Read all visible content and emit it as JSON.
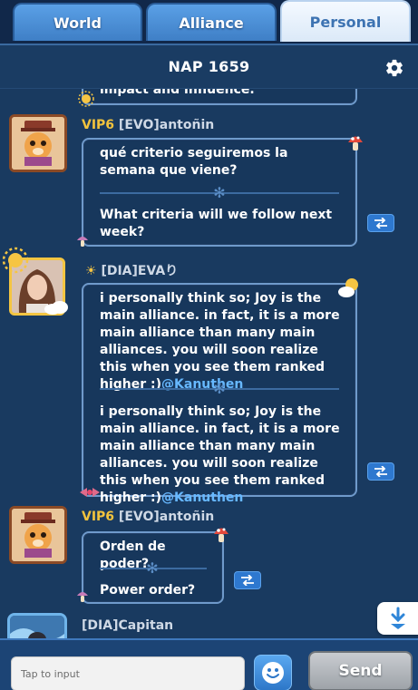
{
  "tabs": [
    {
      "label": "World",
      "active": false
    },
    {
      "label": "Alliance",
      "active": false
    },
    {
      "label": "Personal",
      "active": true
    }
  ],
  "header": {
    "title": "NAP 1659",
    "settings_icon": "gear-icon"
  },
  "messages": [
    {
      "partial_text": "impact and influence."
    },
    {
      "vip": "VIP6",
      "sender": "[EVO]antoñin",
      "original": "qué criterio seguiremos la semana que viene?",
      "translated": "What criteria will we follow next week?"
    },
    {
      "sender": "[DIA]EVAり",
      "original": "i personally think so; Joy is the main alliance. in fact, it is a more main alliance than many main alliances. you will soon realize this when you see them ranked higher :)",
      "original_mention": "@Kanuthen",
      "translated": "i personally think so; Joy is the main alliance. in fact, it is a more main alliance than many main alliances. you will soon realize this when you see them ranked higher :)",
      "translated_mention": "@Kanuthen"
    },
    {
      "vip": "VIP6",
      "sender": "[EVO]antoñin",
      "original": "Orden de poder?",
      "translated": "Power order?"
    },
    {
      "sender": "[DIA]Capitan"
    }
  ],
  "composer": {
    "placeholder": "Tap to input",
    "send_label": "Send"
  },
  "colors": {
    "background": "#193a60",
    "bubble_border": "#6f9acb",
    "vip": "#f2c33d",
    "mention": "#67b8ff",
    "tab_active_text": "#3d73b2"
  }
}
